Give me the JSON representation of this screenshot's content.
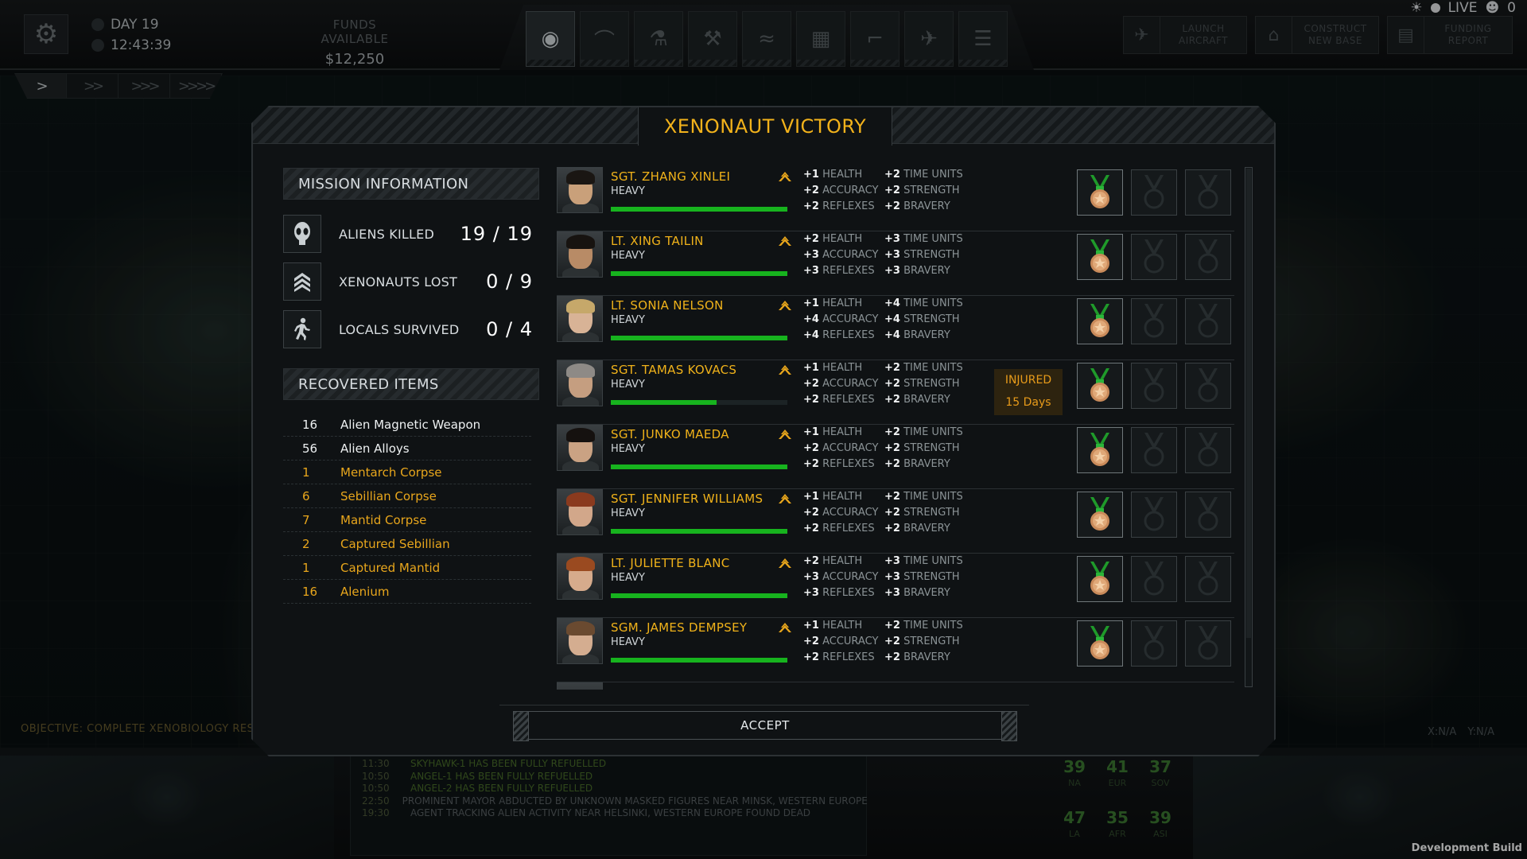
{
  "top": {
    "day_label": "DAY 19",
    "time": "12:43:39",
    "funds_label": "FUNDS AVAILABLE",
    "funds_value": "$12,250",
    "live_label": "LIVE",
    "live_count": "0",
    "actions": [
      {
        "label": "LAUNCH AIRCRAFT",
        "icon": "aircraft-icon"
      },
      {
        "label": "CONSTRUCT NEW BASE",
        "icon": "base-icon"
      },
      {
        "label": "FUNDING REPORT",
        "icon": "report-icon"
      }
    ],
    "nav_tabs": [
      "geoscape-globe-icon",
      "hangar-icon",
      "research-icon",
      "engineering-icon",
      "soldiers-rank-icon",
      "base-layout-icon",
      "weapon-icon",
      "jet-icon",
      "storage-icon"
    ],
    "speeds": [
      ">",
      ">>",
      ">>>",
      ">>>>"
    ]
  },
  "objective": "OBJECTIVE: COMPLETE XENOBIOLOGY RESEAR",
  "coords": "X:N/A Y:N/A",
  "dialog": {
    "title": "XENONAUT VICTORY",
    "mission_info_label": "MISSION INFORMATION",
    "stats": [
      {
        "label": "ALIENS KILLED",
        "value": "19 / 19",
        "icon": "alien-head-icon"
      },
      {
        "label": "XENONAUTS LOST",
        "value": "0 / 9",
        "icon": "rank-chevron-icon"
      },
      {
        "label": "LOCALS SURVIVED",
        "value": "0 / 4",
        "icon": "running-person-icon"
      }
    ],
    "recovered_label": "RECOVERED ITEMS",
    "items": [
      {
        "qty": "16",
        "name": "Alien Magnetic Weapon",
        "color": "#eef1f2"
      },
      {
        "qty": "56",
        "name": "Alien Alloys",
        "color": "#eef1f2"
      },
      {
        "qty": "1",
        "name": "Mentarch Corpse",
        "color": "#e8a61c"
      },
      {
        "qty": "6",
        "name": "Sebillian Corpse",
        "color": "#e8a61c"
      },
      {
        "qty": "7",
        "name": "Mantid Corpse",
        "color": "#e8a61c"
      },
      {
        "qty": "2",
        "name": "Captured Sebillian",
        "color": "#e8a61c"
      },
      {
        "qty": "1",
        "name": "Captured Mantid",
        "color": "#e8a61c"
      },
      {
        "qty": "16",
        "name": "Alenium",
        "color": "#e8a61c"
      }
    ],
    "soldiers": [
      {
        "name": "SGT. ZHANG XINLEI",
        "class": "HEAVY",
        "xp": 1.0,
        "health": "+1",
        "accuracy": "+2",
        "reflexes": "+2",
        "time_units": "+2",
        "strength": "+2",
        "bravery": "+2",
        "injured": false,
        "skin": "#c9a07a",
        "hair": "#1a1613"
      },
      {
        "name": "LT. XING TAILIN",
        "class": "HEAVY",
        "xp": 1.0,
        "health": "+2",
        "accuracy": "+3",
        "reflexes": "+3",
        "time_units": "+3",
        "strength": "+3",
        "bravery": "+3",
        "injured": false,
        "skin": "#b88b66",
        "hair": "#171310"
      },
      {
        "name": "LT. SONIA NELSON",
        "class": "HEAVY",
        "xp": 1.0,
        "health": "+1",
        "accuracy": "+4",
        "reflexes": "+4",
        "time_units": "+4",
        "strength": "+4",
        "bravery": "+4",
        "injured": false,
        "skin": "#d8b396",
        "hair": "#c6a86a"
      },
      {
        "name": "SGT. TAMAS KOVACS",
        "class": "HEAVY",
        "xp": 0.6,
        "health": "+1",
        "accuracy": "+2",
        "reflexes": "+2",
        "time_units": "+2",
        "strength": "+2",
        "bravery": "+2",
        "injured": true,
        "injured_label": "INJURED",
        "injured_days": "15 Days",
        "skin": "#c59e80",
        "hair": "#8e8a86"
      },
      {
        "name": "SGT. JUNKO MAEDA",
        "class": "HEAVY",
        "xp": 1.0,
        "health": "+1",
        "accuracy": "+2",
        "reflexes": "+2",
        "time_units": "+2",
        "strength": "+2",
        "bravery": "+2",
        "injured": false,
        "skin": "#caa283",
        "hair": "#15110f"
      },
      {
        "name": "SGT. JENNIFER WILLIAMS",
        "class": "HEAVY",
        "xp": 1.0,
        "health": "+1",
        "accuracy": "+2",
        "reflexes": "+2",
        "time_units": "+2",
        "strength": "+2",
        "bravery": "+2",
        "injured": false,
        "skin": "#d2a78a",
        "hair": "#8a3a1e"
      },
      {
        "name": "LT. JULIETTE BLANC",
        "class": "HEAVY",
        "xp": 1.0,
        "health": "+2",
        "accuracy": "+3",
        "reflexes": "+3",
        "time_units": "+3",
        "strength": "+3",
        "bravery": "+3",
        "injured": false,
        "skin": "#d6ab8c",
        "hair": "#9a4a20"
      },
      {
        "name": "SGM. JAMES DEMPSEY",
        "class": "HEAVY",
        "xp": 1.0,
        "health": "+1",
        "accuracy": "+2",
        "reflexes": "+2",
        "time_units": "+2",
        "strength": "+2",
        "bravery": "+2",
        "injured": false,
        "skin": "#d4ad90",
        "hair": "#6a4a30"
      }
    ],
    "stat_names": {
      "health": "HEALTH",
      "accuracy": "ACCURACY",
      "reflexes": "REFLEXES",
      "time_units": "TIME UNITS",
      "strength": "STRENGTH",
      "bravery": "BRAVERY"
    },
    "accept_label": "ACCEPT"
  },
  "log": [
    {
      "time": "11:30",
      "msg": "SKYHAWK-1 HAS BEEN FULLY REFUELLED",
      "color": "green"
    },
    {
      "time": "10:50",
      "msg": "ANGEL-1 HAS BEEN FULLY REFUELLED",
      "color": "green"
    },
    {
      "time": "10:50",
      "msg": "ANGEL-2 HAS BEEN FULLY REFUELLED",
      "color": "green"
    },
    {
      "time": "22:50",
      "msg": "PROMINENT MAYOR ABDUCTED BY UNKNOWN MASKED FIGURES NEAR MINSK, WESTERN EUROPE",
      "color": "gray"
    },
    {
      "time": "19:30",
      "msg": "AGENT TRACKING ALIEN ACTIVITY NEAR HELSINKI, WESTERN EUROPE FOUND DEAD",
      "color": "gray"
    }
  ],
  "regions": [
    {
      "value": "39",
      "name": "NA"
    },
    {
      "value": "41",
      "name": "EUR"
    },
    {
      "value": "37",
      "name": "SOV"
    },
    {
      "value": "47",
      "name": "LA"
    },
    {
      "value": "35",
      "name": "AFR"
    },
    {
      "value": "39",
      "name": "ASI"
    }
  ],
  "dev_build": "Development Build"
}
